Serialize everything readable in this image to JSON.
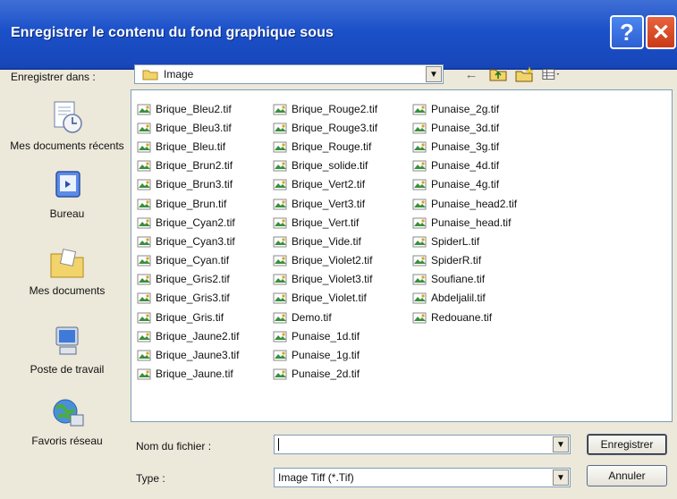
{
  "window": {
    "title": "Enregistrer le contenu du fond graphique sous",
    "help_glyph": "?",
    "close_glyph": "✕"
  },
  "save_in": {
    "label": "Enregistrer dans :",
    "value": "Image"
  },
  "places": [
    {
      "label": "Mes documents récents",
      "icon": "recent-documents-icon"
    },
    {
      "label": "Bureau",
      "icon": "desktop-icon"
    },
    {
      "label": "Mes documents",
      "icon": "my-documents-icon"
    },
    {
      "label": "Poste de travail",
      "icon": "my-computer-icon"
    },
    {
      "label": "Favoris réseau",
      "icon": "network-places-icon"
    }
  ],
  "files": {
    "col1": [
      "Brique_Bleu2.tif",
      "Brique_Bleu3.tif",
      "Brique_Bleu.tif",
      "Brique_Brun2.tif",
      "Brique_Brun3.tif",
      "Brique_Brun.tif",
      "Brique_Cyan2.tif",
      "Brique_Cyan3.tif",
      "Brique_Cyan.tif",
      "Brique_Gris2.tif",
      "Brique_Gris3.tif",
      "Brique_Gris.tif",
      "Brique_Jaune2.tif",
      "Brique_Jaune3.tif",
      "Brique_Jaune.tif"
    ],
    "col2": [
      "Brique_Rouge2.tif",
      "Brique_Rouge3.tif",
      "Brique_Rouge.tif",
      "Brique_solide.tif",
      "Brique_Vert2.tif",
      "Brique_Vert3.tif",
      "Brique_Vert.tif",
      "Brique_Vide.tif",
      "Brique_Violet2.tif",
      "Brique_Violet3.tif",
      "Brique_Violet.tif",
      "Demo.tif",
      "Punaise_1d.tif",
      "Punaise_1g.tif",
      "Punaise_2d.tif"
    ],
    "col3": [
      "Punaise_2g.tif",
      "Punaise_3d.tif",
      "Punaise_3g.tif",
      "Punaise_4d.tif",
      "Punaise_4g.tif",
      "Punaise_head2.tif",
      "Punaise_head.tif",
      "SpiderL.tif",
      "SpiderR.tif",
      "Soufiane.tif",
      "Abdeljalil.tif",
      "Redouane.tif"
    ]
  },
  "filename": {
    "label": "Nom du fichier :",
    "value": ""
  },
  "type": {
    "label": "Type :",
    "value": "Image Tiff (*.Tif)"
  },
  "buttons": {
    "save": "Enregistrer",
    "cancel": "Annuler"
  },
  "colors": {
    "titlebar": "#1b50c8",
    "dialog_bg": "#ece8da",
    "close_button": "#c93a16"
  }
}
